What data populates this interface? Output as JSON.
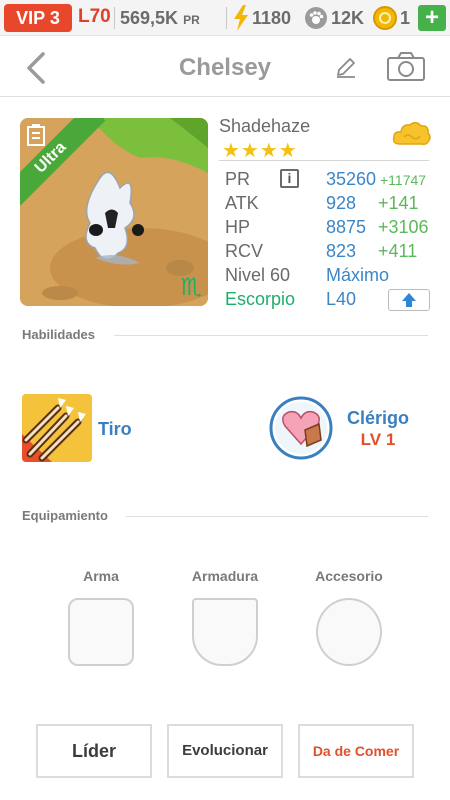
{
  "topbar": {
    "vip": "VIP 3",
    "level": "L70",
    "pr_value": "569,5K",
    "pr_unit": "PR",
    "energy": "1180",
    "paws": "12K",
    "coins": "1",
    "plus": "+"
  },
  "header": {
    "title": "Chelsey"
  },
  "hero": {
    "rarity_ribbon": "Ultra",
    "name": "Shadehaze",
    "stars": "★★★★",
    "stats": [
      {
        "label": "PR",
        "value": "35260",
        "bonus": "+11747"
      },
      {
        "label": "ATK",
        "value": "928",
        "bonus": "+141"
      },
      {
        "label": "HP",
        "value": "8875",
        "bonus": "+3106"
      },
      {
        "label": "RCV",
        "value": "823",
        "bonus": "+411"
      },
      {
        "label": "Nivel 60",
        "value": "Máximo",
        "bonus": ""
      },
      {
        "label": "Escorpio",
        "value": "L40",
        "bonus": ""
      }
    ],
    "info_icon": "i",
    "zodiac_glyph": "♏"
  },
  "abilities": {
    "section_title": "Habilidades",
    "skill_name": "Tiro",
    "class_name": "Clérigo",
    "class_level": "LV 1"
  },
  "equipment": {
    "section_title": "Equipamiento",
    "slots": [
      "Arma",
      "Armadura",
      "Accesorio"
    ]
  },
  "actions": {
    "leader": "Líder",
    "evolve": "Evolucionar",
    "feed": "Da de Comer"
  },
  "colors": {
    "vip_bg": "#e8472b",
    "accent_blue": "#3a86c8",
    "bonus_green": "#5bb85b",
    "zodiac_green": "#1fae6a",
    "star_gold": "#f4c011",
    "feed_orange": "#e0502a"
  }
}
